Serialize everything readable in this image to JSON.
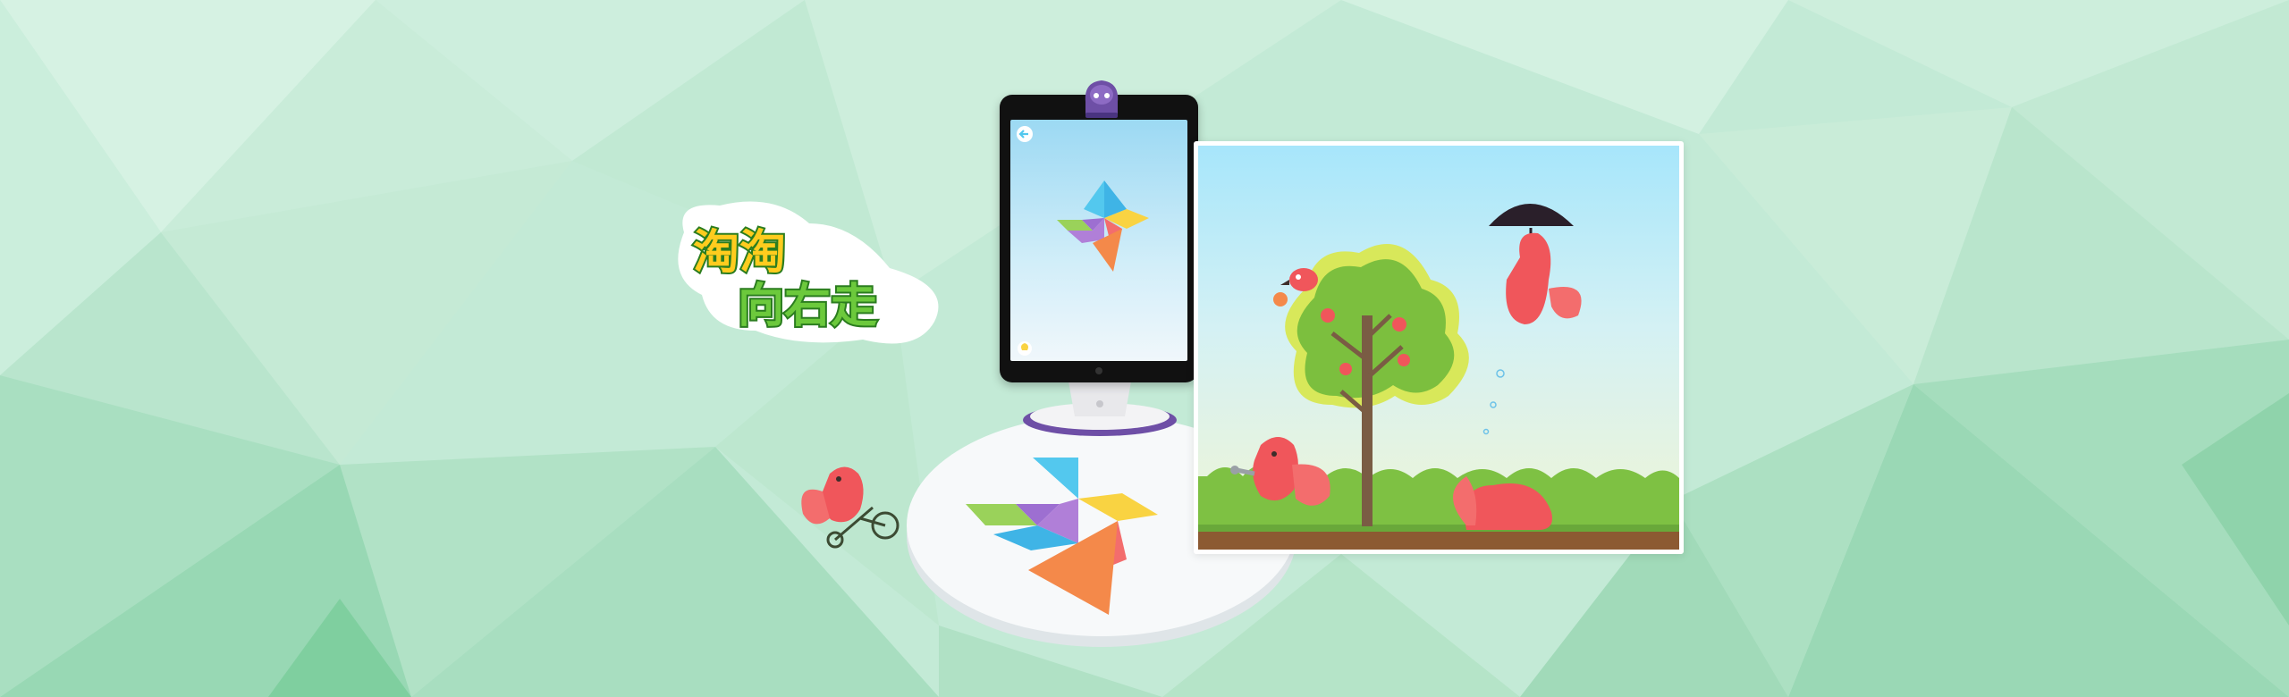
{
  "banner": {
    "logo": {
      "line1": "淘淘",
      "line2": "向右走",
      "colors": {
        "fill": "#ffcc1e",
        "fill2": "#6cc93c",
        "outline": "#2b7d1f",
        "badge": "#ffffff"
      }
    },
    "tablet": {
      "back_icon": "back-arrow-icon",
      "hint_icon": "lightbulb-icon",
      "puzzle": "tangram-bird"
    },
    "colors": {
      "background": "#bfe9d4",
      "squirrel": "#f0565b",
      "tangram_blue": "#53c8ee",
      "tangram_purple": "#9d6fd1",
      "tangram_green": "#9ad25a",
      "tangram_yellow": "#f9d342",
      "tangram_orange": "#f4894a",
      "tangram_pink": "#f36d6d",
      "stand_purple": "#6e4fa6"
    }
  }
}
